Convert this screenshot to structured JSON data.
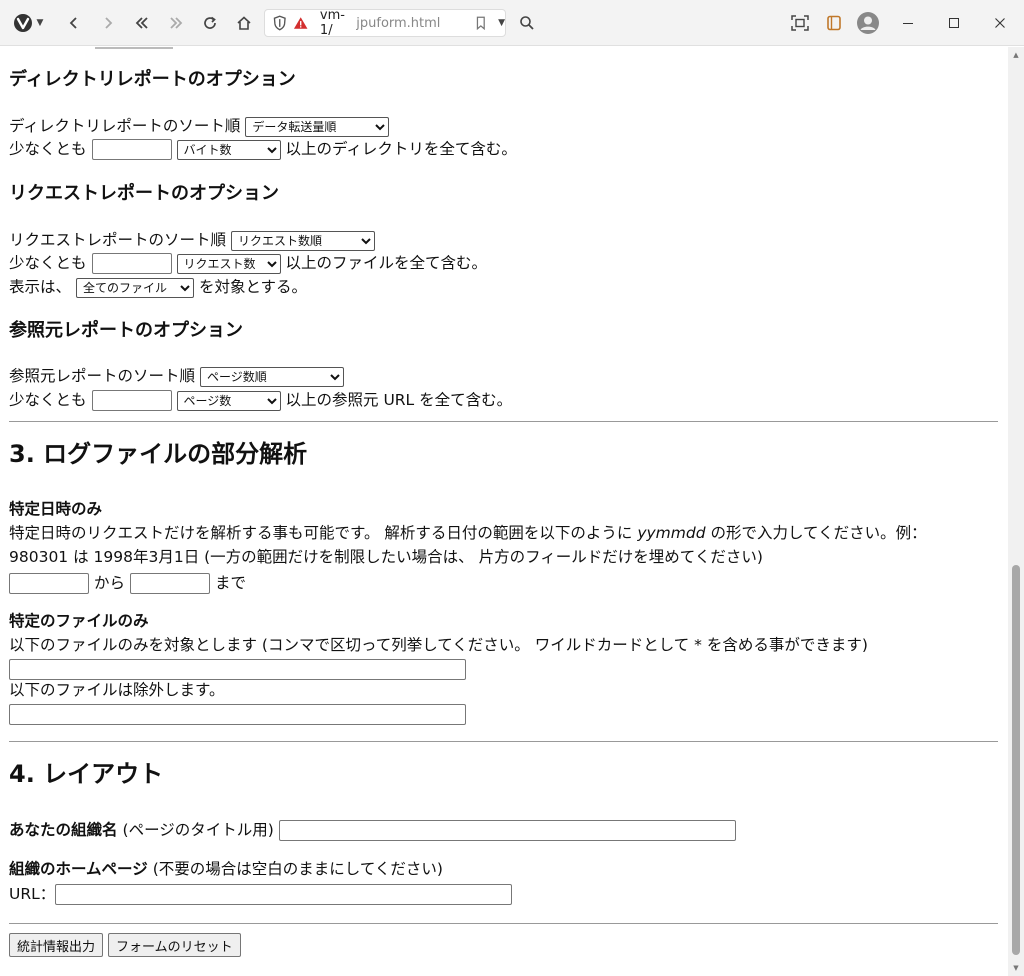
{
  "browser": {
    "url_host": "vm-1/",
    "url_path": "jpuform.html"
  },
  "dir_report": {
    "heading": "ディレクトリレポートのオプション",
    "sort_label": "ディレクトリレポートのソート順",
    "sort_value": "データ転送量順",
    "atleast_label": "少なくとも",
    "unit_value": "バイト数",
    "atleast_suffix": "以上のディレクトリを全て含む。"
  },
  "req_report": {
    "heading": "リクエストレポートのオプション",
    "sort_label": "リクエストレポートのソート順",
    "sort_value": "リクエスト数順",
    "atleast_label": "少なくとも",
    "unit_value": "リクエスト数",
    "atleast_suffix": "以上のファイルを全て含む。",
    "show_label": "表示は、",
    "show_value": "全てのファイル",
    "show_suffix": "を対象とする。"
  },
  "ref_report": {
    "heading": "参照元レポートのオプション",
    "sort_label": "参照元レポートのソート順",
    "sort_value": "ページ数順",
    "atleast_label": "少なくとも",
    "unit_value": "ページ数",
    "atleast_suffix": "以上の参照元 URL を全て含む。"
  },
  "partial": {
    "heading": "3. ログファイルの部分解析",
    "date_title": "特定日時のみ",
    "date_desc_pre": "特定日時のリクエストだけを解析する事も可能です。 解析する日付の範囲を以下のように",
    "date_desc_em": "yymmdd",
    "date_desc_post": "の形で入力してください。例：",
    "date_desc_line2": "980301 は 1998年3月1日 (一方の範囲だけを制限したい場合は、 片方のフィールドだけを埋めてください)",
    "from_label": "から",
    "to_label": "まで",
    "file_title": "特定のファイルのみ",
    "include_desc": "以下のファイルのみを対象とします (コンマで区切って列挙してください。 ワイルドカードとして * を含める事ができます)",
    "exclude_desc": "以下のファイルは除外します。"
  },
  "layout": {
    "heading": "4. レイアウト",
    "org_label_bold": "あなたの組織名",
    "org_label_note": "(ページのタイトル用)",
    "home_label_bold": "組織のホームページ",
    "home_label_note": "(不要の場合は空白のままにしてください)",
    "url_label": "URL："
  },
  "buttons": {
    "submit": "統計情報出力",
    "reset": "フォームのリセット"
  }
}
